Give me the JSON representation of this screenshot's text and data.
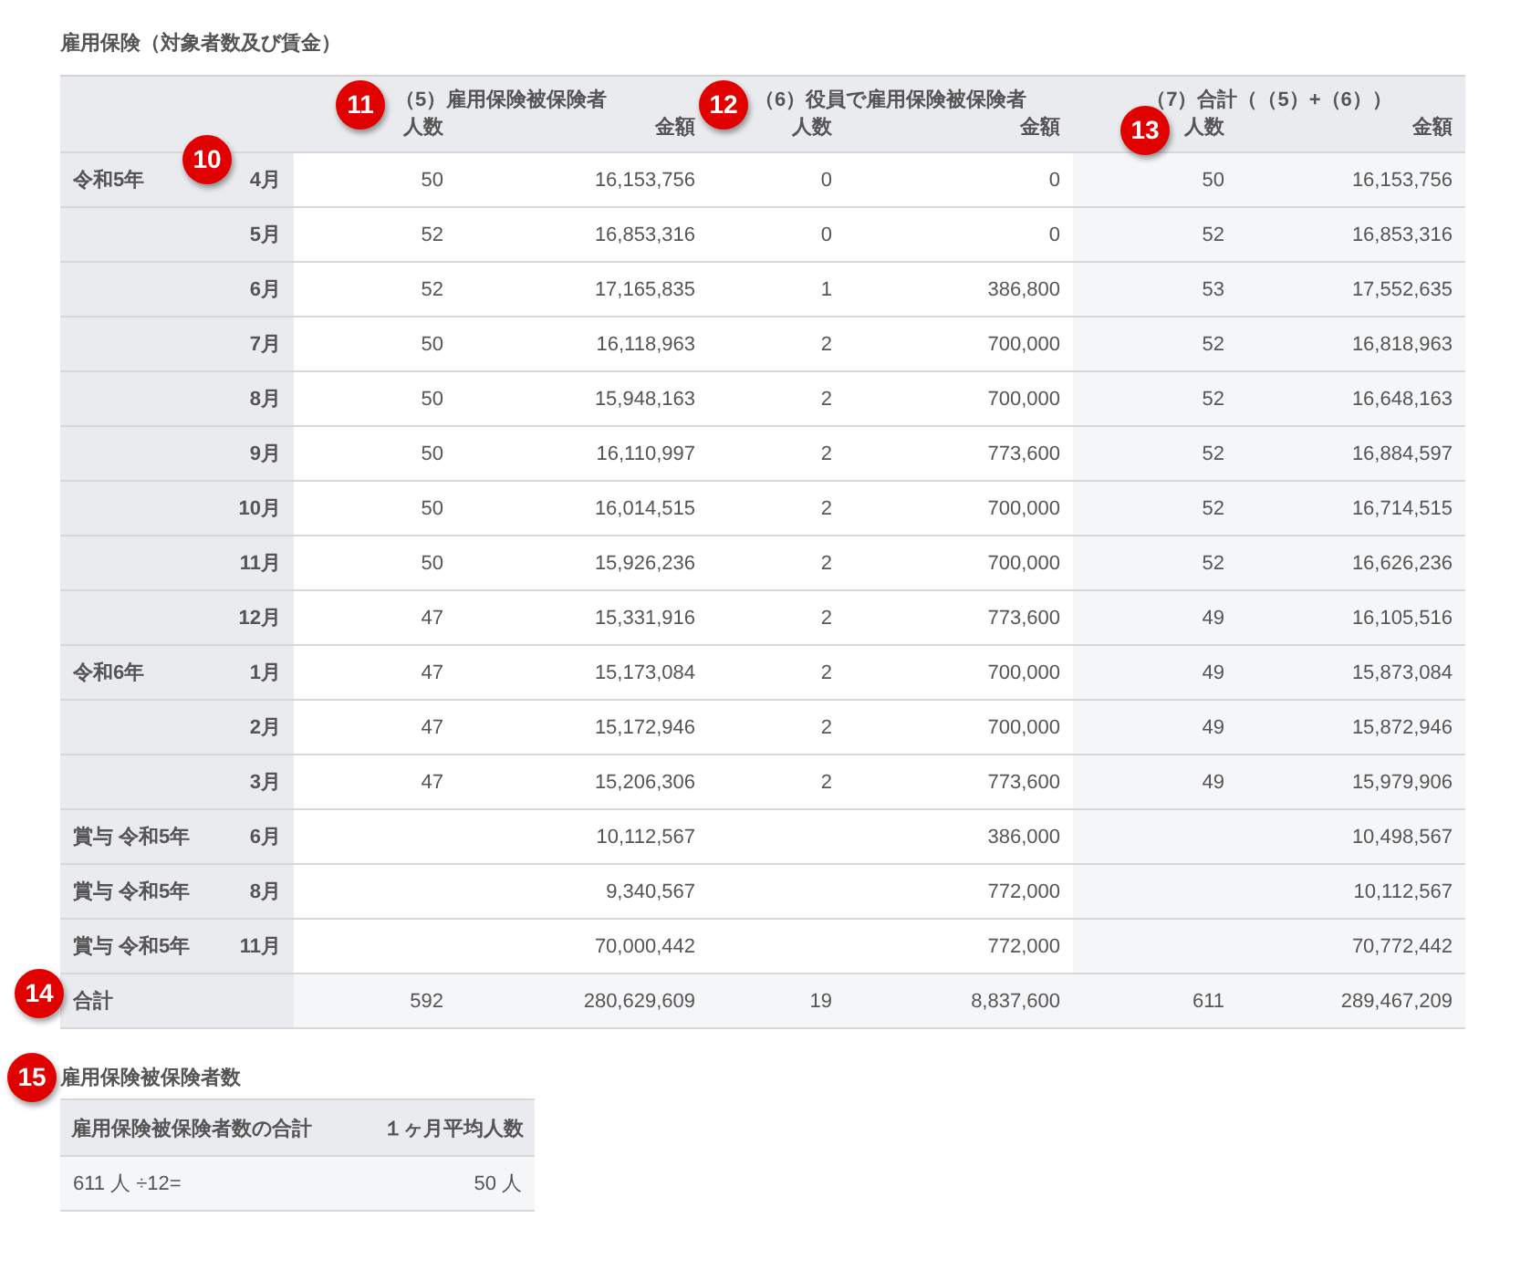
{
  "title": "雇用保険（対象者数及び賃金）",
  "table": {
    "groups": [
      "（5）雇用保険被保険者",
      "（6）役員で雇用保険被保険者",
      "（7）合計（（5）+（6））"
    ],
    "columns": [
      "人数",
      "金額",
      "人数",
      "金額",
      "人数",
      "金額"
    ],
    "rows": [
      {
        "kind": "month",
        "year": "令和5年",
        "month": "4月",
        "cells": [
          "50",
          "16,153,756",
          "0",
          "0",
          "50",
          "16,153,756"
        ]
      },
      {
        "kind": "month",
        "month": "5月",
        "cells": [
          "52",
          "16,853,316",
          "0",
          "0",
          "52",
          "16,853,316"
        ]
      },
      {
        "kind": "month",
        "month": "6月",
        "cells": [
          "52",
          "17,165,835",
          "1",
          "386,800",
          "53",
          "17,552,635"
        ]
      },
      {
        "kind": "month",
        "month": "7月",
        "cells": [
          "50",
          "16,118,963",
          "2",
          "700,000",
          "52",
          "16,818,963"
        ]
      },
      {
        "kind": "month",
        "month": "8月",
        "cells": [
          "50",
          "15,948,163",
          "2",
          "700,000",
          "52",
          "16,648,163"
        ]
      },
      {
        "kind": "month",
        "month": "9月",
        "cells": [
          "50",
          "16,110,997",
          "2",
          "773,600",
          "52",
          "16,884,597"
        ]
      },
      {
        "kind": "month",
        "month": "10月",
        "cells": [
          "50",
          "16,014,515",
          "2",
          "700,000",
          "52",
          "16,714,515"
        ]
      },
      {
        "kind": "month",
        "month": "11月",
        "cells": [
          "50",
          "15,926,236",
          "2",
          "700,000",
          "52",
          "16,626,236"
        ]
      },
      {
        "kind": "month",
        "month": "12月",
        "cells": [
          "47",
          "15,331,916",
          "2",
          "773,600",
          "49",
          "16,105,516"
        ]
      },
      {
        "kind": "month",
        "year": "令和6年",
        "month": "1月",
        "cells": [
          "47",
          "15,173,084",
          "2",
          "700,000",
          "49",
          "15,873,084"
        ]
      },
      {
        "kind": "month",
        "month": "2月",
        "cells": [
          "47",
          "15,172,946",
          "2",
          "700,000",
          "49",
          "15,872,946"
        ]
      },
      {
        "kind": "month",
        "month": "3月",
        "cells": [
          "47",
          "15,206,306",
          "2",
          "773,600",
          "49",
          "15,979,906"
        ]
      },
      {
        "kind": "month",
        "year": "賞与 令和5年",
        "month": "6月",
        "cells": [
          "",
          "10,112,567",
          "",
          "386,000",
          "",
          "10,498,567"
        ]
      },
      {
        "kind": "month",
        "year": "賞与 令和5年",
        "month": "8月",
        "cells": [
          "",
          "9,340,567",
          "",
          "772,000",
          "",
          "10,112,567"
        ]
      },
      {
        "kind": "month",
        "year": "賞与 令和5年",
        "month": "11月",
        "cells": [
          "",
          "70,000,442",
          "",
          "772,000",
          "",
          "70,772,442"
        ]
      },
      {
        "kind": "total",
        "year": "合計",
        "cells": [
          "592",
          "280,629,609",
          "19",
          "8,837,600",
          "611",
          "289,467,209"
        ]
      }
    ]
  },
  "summary": {
    "title": "雇用保険被保険者数",
    "columns": [
      "雇用保険被保険者数の合計",
      "１ヶ月平均人数"
    ],
    "cells": [
      "611 人 ÷12=",
      "50 人"
    ]
  },
  "callouts": [
    "10",
    "11",
    "12",
    "13",
    "14",
    "15"
  ]
}
